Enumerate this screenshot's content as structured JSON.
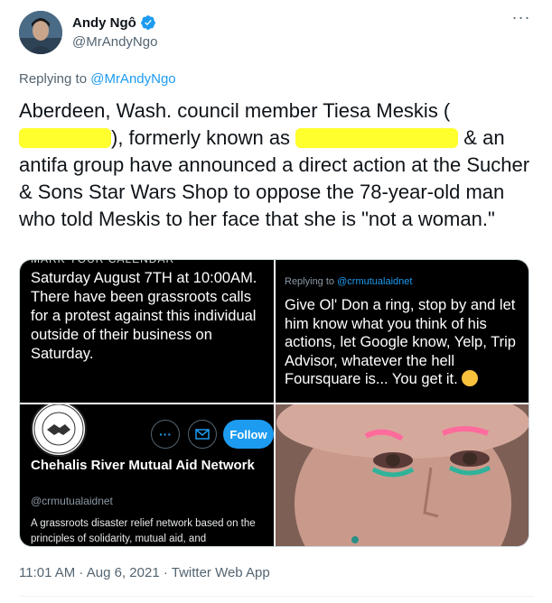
{
  "author": {
    "display_name": "Andy Ngô",
    "handle": "@MrAndyNgo",
    "avatar_icon": "avatar-portrait",
    "verified_icon": "verified-badge-icon",
    "verified_color": "#1d9bf0"
  },
  "more_icon": "more-horizontal-icon",
  "reply": {
    "prefix": "Replying to",
    "to_handle": "@MrAndyNgo"
  },
  "tweet": {
    "text_part1": "Aberdeen, Wash. council member Tiesa Meskis (",
    "text_part2": "), formerly known as",
    "text_part3": " & an antifa group have announced a direct action at the Sucher & Sons Star Wars Shop to oppose the 78-year-old man who told Meskis to her face that she is \"not a woman.\"",
    "redaction_color": "#ffff2e"
  },
  "media": {
    "image1": {
      "body": "Saturday August 7TH at 10:00AM.\nThere have been grassroots calls for a protest against this individual outside of their business on Saturday."
    },
    "image2": {
      "reply_prefix": "Replying to",
      "reply_handle": "@crmutualaidnet",
      "body": "Give Ol' Don a ring, stop by and let him know what you think of his actions, let Google know, Yelp, Trip Advisor, whatever the hell Foursquare is... You get it.",
      "emoji": "winking-face-emoji"
    },
    "image3": {
      "logo_icon": "handshake-logo-icon",
      "more_label": "···",
      "message_icon": "envelope-icon",
      "follow_label": "Follow",
      "org_name": "Chehalis River Mutual Aid Network",
      "org_handle": "@crmutualaidnet",
      "bio": "A grassroots disaster relief network based on the principles of solidarity, mutual aid, and"
    },
    "image4": {
      "description_icon": "face-photo"
    }
  },
  "footer": {
    "timestamp": "11:01 AM · Aug 6, 2021 · Twitter Web App"
  },
  "colors": {
    "accent": "#1d9bf0",
    "secondary_text": "#536471",
    "primary_text": "#0f1419"
  }
}
